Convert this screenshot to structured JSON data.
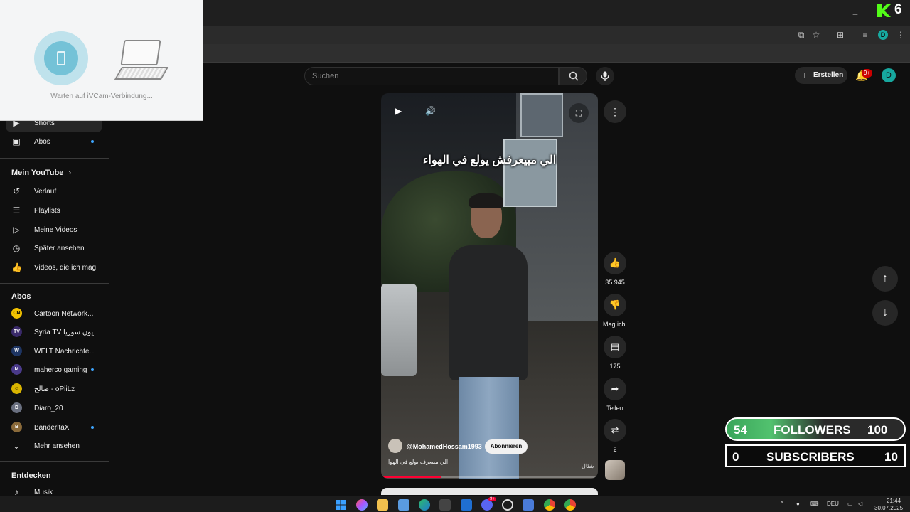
{
  "ivcam": {
    "status": "Warten auf iVCam-Verbindung..."
  },
  "overlay_logo": {
    "number": "6"
  },
  "masthead": {
    "search_placeholder": "Suchen",
    "create_label": "Erstellen",
    "notification_count": "9+",
    "avatar_letter": "D"
  },
  "browser": {
    "profile_letter": "D"
  },
  "sidebar": {
    "top_items": [
      {
        "label": "Shorts",
        "icon": "shorts-icon"
      },
      {
        "label": "Abos",
        "icon": "subscriptions-icon"
      }
    ],
    "you_title": "Mein YouTube",
    "you_items": [
      {
        "label": "Verlauf",
        "icon": "history-icon"
      },
      {
        "label": "Playlists",
        "icon": "playlists-icon"
      },
      {
        "label": "Meine Videos",
        "icon": "my-videos-icon"
      },
      {
        "label": "Später ansehen",
        "icon": "watch-later-icon"
      },
      {
        "label": "Videos, die ich mag",
        "icon": "liked-icon"
      }
    ],
    "subs_title": "Abos",
    "subs": [
      {
        "label": "Cartoon Network...",
        "badge": "CN",
        "color": "#f2c200"
      },
      {
        "label": "Syria TV تلفزيون سوريا",
        "badge": "TV",
        "color": "#3a2a6a"
      },
      {
        "label": "WELT Nachrichte...",
        "badge": "W",
        "color": "#1e3563"
      },
      {
        "label": "maherco gaming",
        "badge": "M",
        "color": "#4a3a8a"
      },
      {
        "label": "صالح - oPiiLz",
        "badge": "☺",
        "color": "#d9b400"
      },
      {
        "label": "Diaro_20",
        "badge": "D",
        "color": "#6a7080"
      },
      {
        "label": "BanderitaX",
        "badge": "B",
        "color": "#8a6a3a"
      }
    ],
    "more_label": "Mehr ansehen",
    "explore_title": "Entdecken",
    "explore_items": [
      {
        "label": "Musik",
        "icon": "music-icon"
      }
    ]
  },
  "video": {
    "caption": "الي مبيعرفش يولع في الهواء",
    "channel": "@MohamedHossam1993",
    "subscribe_label": "Abonnieren",
    "title": "الي مبيعرف يولع في الهوا",
    "shorts_tag": "شئال",
    "progress": 0.28
  },
  "actions": {
    "likes": "35.945",
    "dislike_label": "Mag ich .",
    "comments": "175",
    "share_label": "Teilen",
    "remix_count": "2"
  },
  "widgets": {
    "followers": {
      "current": "54",
      "label": "FOLLOWERS",
      "goal": "100"
    },
    "subscribers": {
      "current": "0",
      "label": "SUBSCRIBERS",
      "goal": "10"
    }
  },
  "taskbar": {
    "lang": "DEU",
    "time": "21:44",
    "date": "30.07.2025",
    "discord_badge": "9+"
  }
}
